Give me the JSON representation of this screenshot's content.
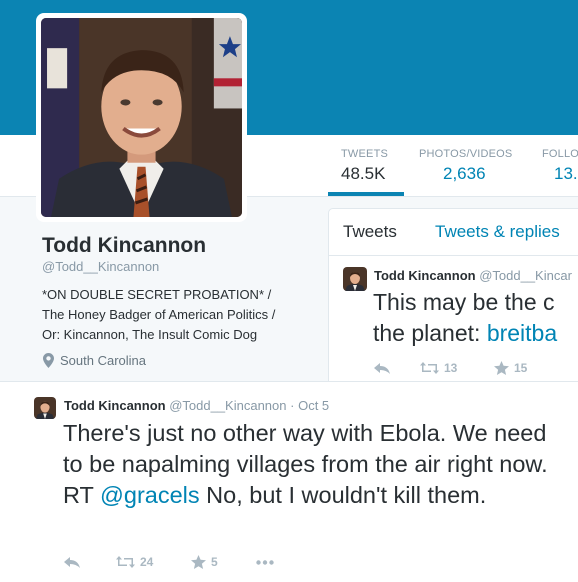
{
  "stats": [
    {
      "label": "TWEETS",
      "value": "48.5K"
    },
    {
      "label": "PHOTOS/VIDEOS",
      "value": "2,636"
    },
    {
      "label": "FOLLO",
      "value": "13."
    }
  ],
  "profile": {
    "name": "Todd Kincannon",
    "handle": "@Todd__Kincannon",
    "bio_lines": [
      "*ON DOUBLE SECRET PROBATION* /",
      "The Honey Badger of American Politics /",
      "Or: Kincannon, The Insult Comic Dog"
    ],
    "location": "South Carolina"
  },
  "tabs": {
    "tweets": "Tweets",
    "replies": "Tweets & replies"
  },
  "tweet_preview": {
    "name": "Todd Kincannon",
    "handle": "@Todd__Kincar",
    "text_line1": "This may be the c",
    "text_line2_prefix": "the planet: ",
    "text_line2_link": "breitba",
    "retweets": "13",
    "favorites": "15"
  },
  "featured_tweet": {
    "name": "Todd Kincannon",
    "handle": "@Todd__Kincannon",
    "dot": "·",
    "date": "Oct 5",
    "text_before": "There's just no other way with Ebola. We need to be napalming villages from the air right now. RT ",
    "mention": "@gracels",
    "text_after": " No, but I wouldn't kill them.",
    "retweets": "24",
    "favorites": "5"
  },
  "icons": {
    "location": "location-pin-icon",
    "reply": "reply-arrow-icon",
    "retweet": "retweet-icon",
    "favorite": "star-icon",
    "more": "more-dots-icon"
  },
  "colors": {
    "banner": "#0b84b3",
    "link": "#0084b4",
    "muted": "#8899a6",
    "action": "#aab8c2"
  }
}
